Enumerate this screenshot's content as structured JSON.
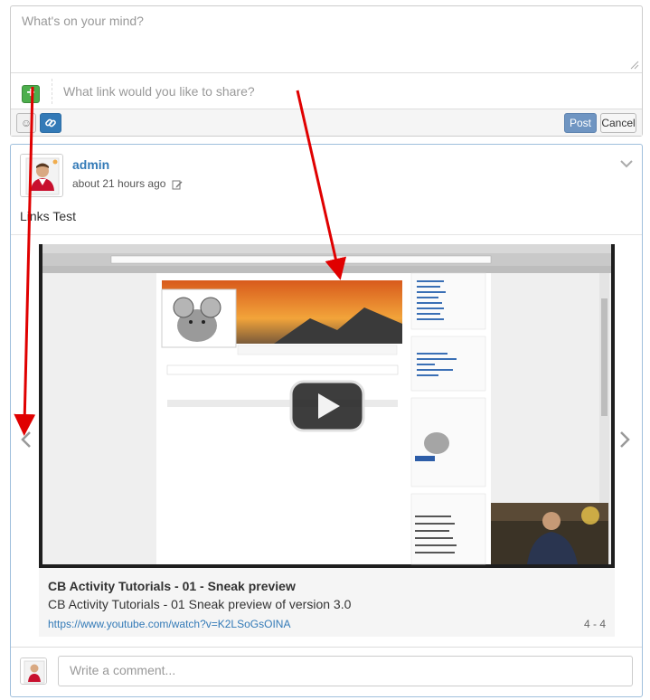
{
  "composer": {
    "status_placeholder": "What's on your mind?",
    "link_placeholder": "What link would you like to share?",
    "toggle_symbol": "+",
    "emoji_symbol": "☺",
    "post_label": "Post",
    "cancel_label": "Cancel"
  },
  "activity": {
    "author": "admin",
    "timestamp": "about 21 hours ago",
    "message": "Links Test",
    "link": {
      "title": "CB Activity Tutorials - 01 - Sneak preview",
      "description": "CB Activity Tutorials - 01 Sneak preview of version 3.0",
      "url": "https://www.youtube.com/watch?v=K2LSoGsOINA",
      "count": "4 - 4"
    },
    "comment_placeholder": "Write a comment..."
  },
  "icons": {
    "edit": "edit-icon",
    "menu": "chevron-down-icon",
    "prev": "chevron-left-icon",
    "next": "chevron-right-icon",
    "play": "play-icon",
    "link": "link-icon",
    "emoji": "smiley-icon"
  },
  "colors": {
    "link": "#337ab7",
    "post_button": "#6f95c2",
    "toggle_green": "#4cae4c",
    "card_border": "#9fbfdc",
    "annotation_red": "#e00000"
  }
}
